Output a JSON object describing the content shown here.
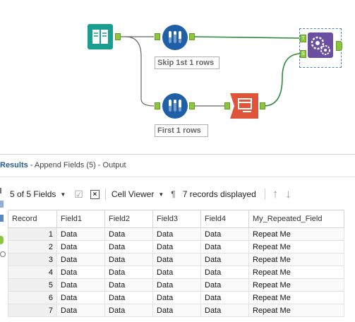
{
  "workflow": {
    "tools": [
      {
        "name": "Input Data",
        "icon": "book-icon"
      },
      {
        "name": "Sample",
        "label": "Skip 1st 1 rows",
        "icon": "test-tubes-icon"
      },
      {
        "name": "Sample",
        "label": "First 1 rows",
        "icon": "test-tubes-icon"
      },
      {
        "name": "Cross Tab",
        "icon": "crosstab-icon"
      },
      {
        "name": "Append Fields",
        "icon": "gears-icon",
        "anchors": [
          "T",
          "S"
        ]
      }
    ]
  },
  "results": {
    "title": "Results",
    "subtitle": "- Append Fields (5) - Output"
  },
  "toolbar": {
    "fields_label": "5 of 5 Fields",
    "viewer_label": "Cell Viewer",
    "pilcrow": "¶",
    "records_label": "7 records displayed"
  },
  "grid": {
    "columns": [
      "Record",
      "Field1",
      "Field2",
      "Field3",
      "Field4",
      "My_Repeated_Field"
    ],
    "rows": [
      [
        "1",
        "Data",
        "Data",
        "Data",
        "Data",
        "Repeat Me"
      ],
      [
        "2",
        "Data",
        "Data",
        "Data",
        "Data",
        "Repeat Me"
      ],
      [
        "3",
        "Data",
        "Data",
        "Data",
        "Data",
        "Repeat Me"
      ],
      [
        "4",
        "Data",
        "Data",
        "Data",
        "Data",
        "Repeat Me"
      ],
      [
        "5",
        "Data",
        "Data",
        "Data",
        "Data",
        "Repeat Me"
      ],
      [
        "6",
        "Data",
        "Data",
        "Data",
        "Data",
        "Repeat Me"
      ],
      [
        "7",
        "Data",
        "Data",
        "Data",
        "Data",
        "Repeat Me"
      ]
    ]
  },
  "colors": {
    "input": "#1a9e8f",
    "sample": "#1f5fa8",
    "crosstab": "#e0553a",
    "append": "#6b4fa0",
    "anchor": "#8cc63f",
    "connection": "#2e8b3a"
  }
}
